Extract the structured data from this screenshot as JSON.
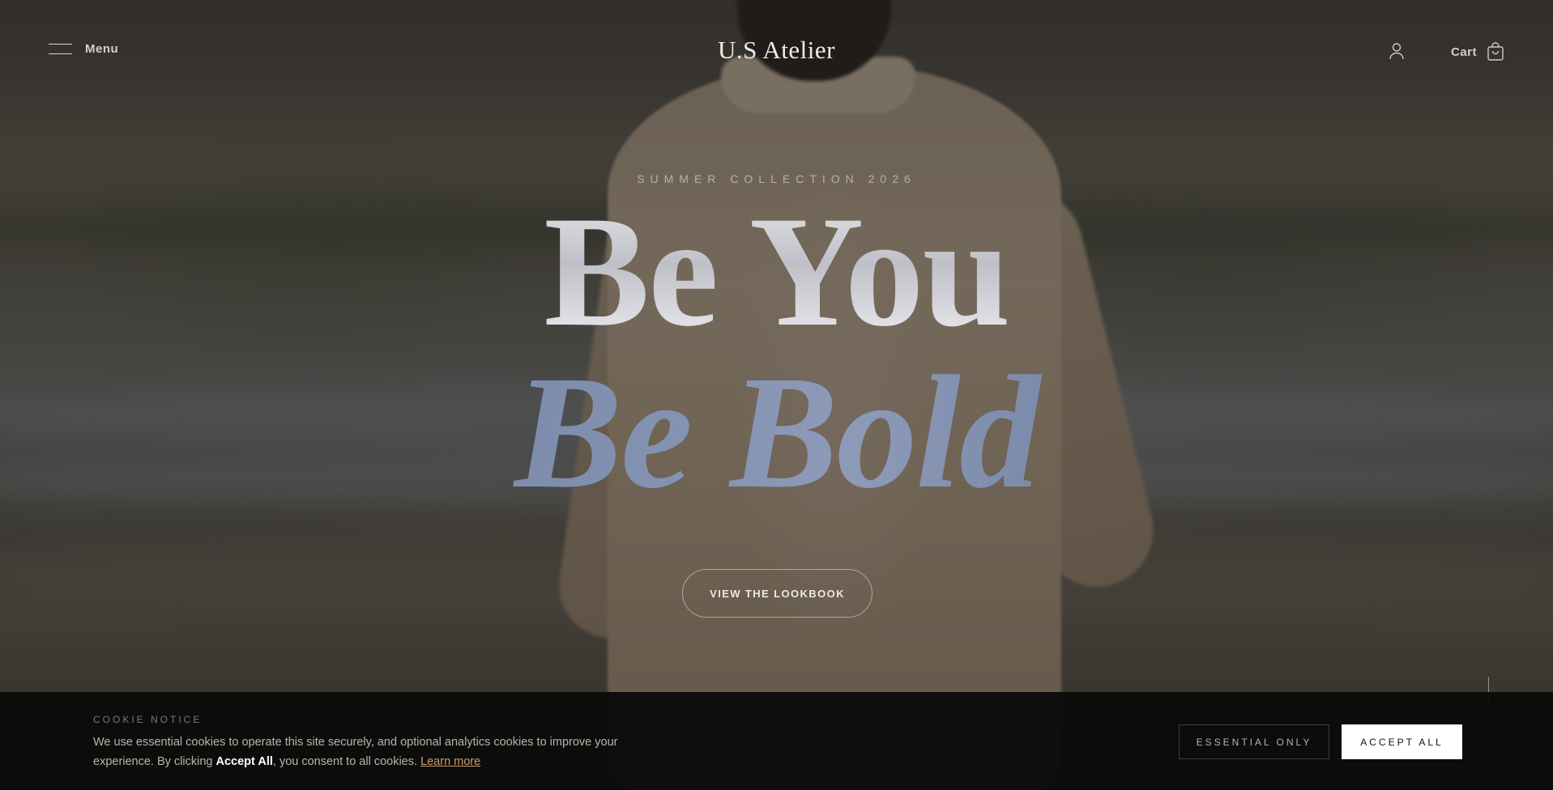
{
  "header": {
    "menu_label": "Menu",
    "brand": "U.S Atelier",
    "cart_label": "Cart"
  },
  "hero": {
    "eyebrow": "SUMMER COLLECTION 2026",
    "headline_line1": "Be You",
    "headline_line2": "Be Bold",
    "cta_label": "VIEW THE LOOKBOOK"
  },
  "cookie": {
    "title": "COOKIE NOTICE",
    "text_part1": "We use essential cookies to operate this site securely, and optional analytics cookies to improve your experience. By clicking ",
    "text_bold": "Accept All",
    "text_part2": ", you consent to all cookies. ",
    "learn_more": "Learn more",
    "essential_label": "ESSENTIAL ONLY",
    "accept_label": "ACCEPT ALL"
  },
  "icons": {
    "menu": "hamburger-icon",
    "account": "user-icon",
    "cart": "shopping-bag-icon"
  },
  "colors": {
    "accent_link": "#c9a067",
    "headline_italic": "#7b8aab",
    "banner_bg": "#0a0a0a"
  }
}
